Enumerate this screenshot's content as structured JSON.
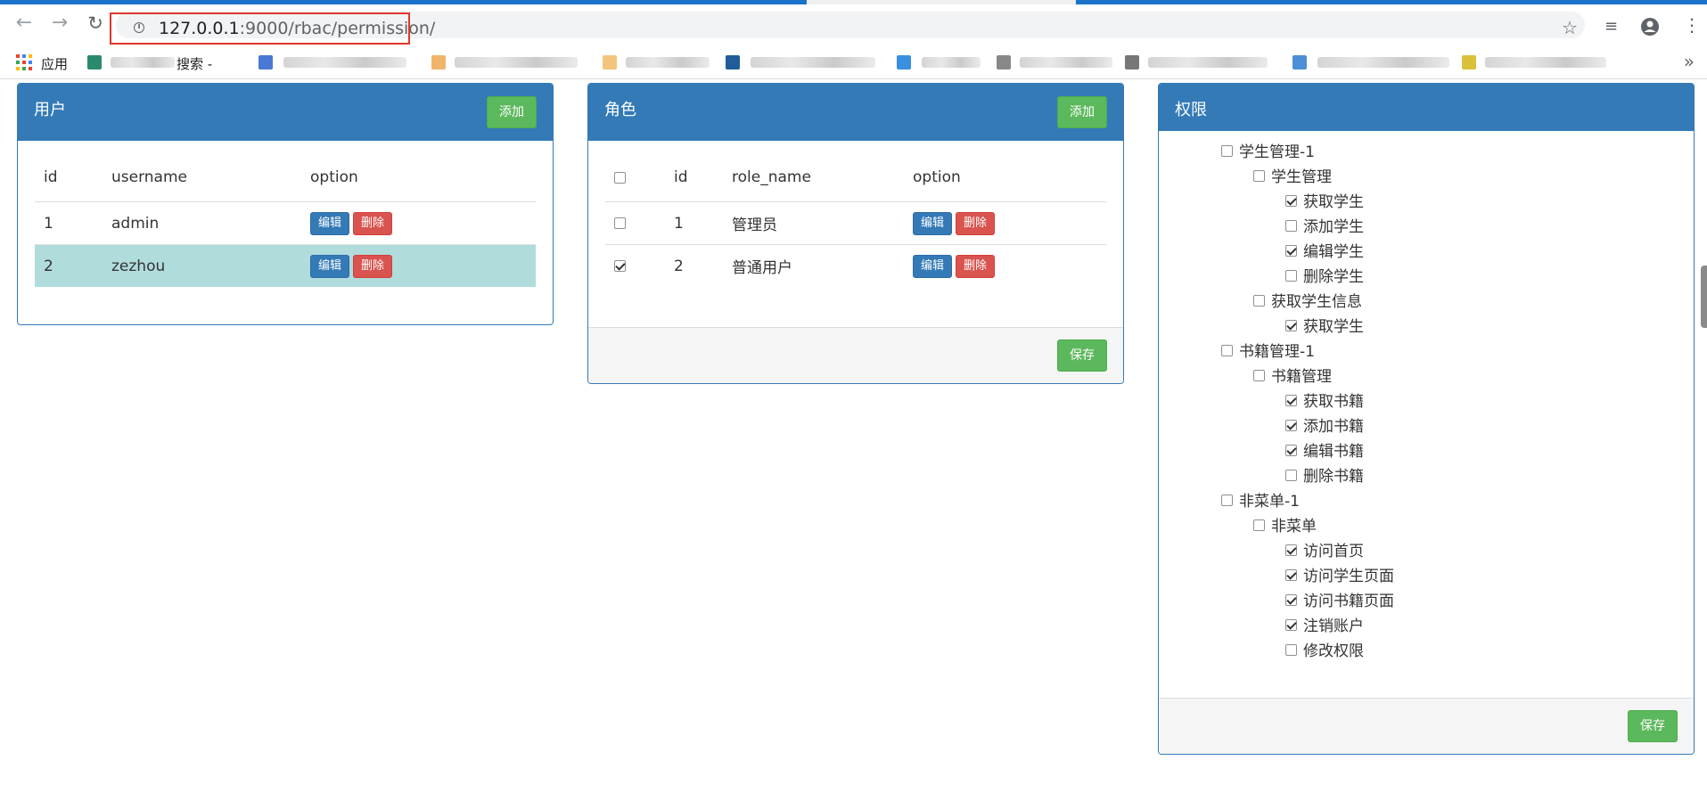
{
  "browser": {
    "url_host": "127.0.0.1",
    "url_rest": ":9000/rbac/permission/",
    "bookmarks": {
      "apps_label": "应用",
      "item1_label": "搜索 -"
    }
  },
  "icons": {
    "back": "arrow-left-icon",
    "forward": "arrow-right-icon",
    "reload": "reload-icon",
    "info": "info-icon",
    "star": "star-icon",
    "media": "media-icon",
    "account": "account-icon",
    "menu": "menu-icon"
  },
  "users_panel": {
    "title": "用户",
    "add_label": "添加",
    "columns": [
      "id",
      "username",
      "option"
    ],
    "rows": [
      {
        "id": "1",
        "username": "admin",
        "edit": "编辑",
        "delete": "删除",
        "highlight": false
      },
      {
        "id": "2",
        "username": "zezhou",
        "edit": "编辑",
        "delete": "删除",
        "highlight": true
      }
    ]
  },
  "roles_panel": {
    "title": "角色",
    "add_label": "添加",
    "columns": [
      "id",
      "role_name",
      "option"
    ],
    "rows": [
      {
        "id": "1",
        "role_name": "管理员",
        "edit": "编辑",
        "delete": "删除",
        "checked": false
      },
      {
        "id": "2",
        "role_name": "普通用户",
        "edit": "编辑",
        "delete": "删除",
        "checked": true
      }
    ],
    "save_label": "保存"
  },
  "permissions_panel": {
    "title": "权限",
    "save_label": "保存",
    "tree": [
      {
        "label": "学生管理-1",
        "level": 0,
        "checked": false
      },
      {
        "label": "学生管理",
        "level": 1,
        "checked": false
      },
      {
        "label": "获取学生",
        "level": 2,
        "checked": true
      },
      {
        "label": "添加学生",
        "level": 2,
        "checked": false
      },
      {
        "label": "编辑学生",
        "level": 2,
        "checked": true
      },
      {
        "label": "删除学生",
        "level": 2,
        "checked": false
      },
      {
        "label": "获取学生信息",
        "level": 1,
        "checked": false
      },
      {
        "label": "获取学生",
        "level": 2,
        "checked": true
      },
      {
        "label": "书籍管理-1",
        "level": 0,
        "checked": false
      },
      {
        "label": "书籍管理",
        "level": 1,
        "checked": false
      },
      {
        "label": "获取书籍",
        "level": 2,
        "checked": true
      },
      {
        "label": "添加书籍",
        "level": 2,
        "checked": true
      },
      {
        "label": "编辑书籍",
        "level": 2,
        "checked": true
      },
      {
        "label": "删除书籍",
        "level": 2,
        "checked": false
      },
      {
        "label": "非菜单-1",
        "level": 0,
        "checked": false
      },
      {
        "label": "非菜单",
        "level": 1,
        "checked": false
      },
      {
        "label": "访问首页",
        "level": 2,
        "checked": true
      },
      {
        "label": "访问学生页面",
        "level": 2,
        "checked": true
      },
      {
        "label": "访问书籍页面",
        "level": 2,
        "checked": true
      },
      {
        "label": "注销账户",
        "level": 2,
        "checked": true
      },
      {
        "label": "修改权限",
        "level": 2,
        "checked": false
      }
    ]
  },
  "colors": {
    "primary": "#337ab7",
    "success": "#5cb85c",
    "danger": "#d9534f",
    "row_highlight": "#b0dcdc",
    "url_highlight_border": "#e0362c"
  }
}
